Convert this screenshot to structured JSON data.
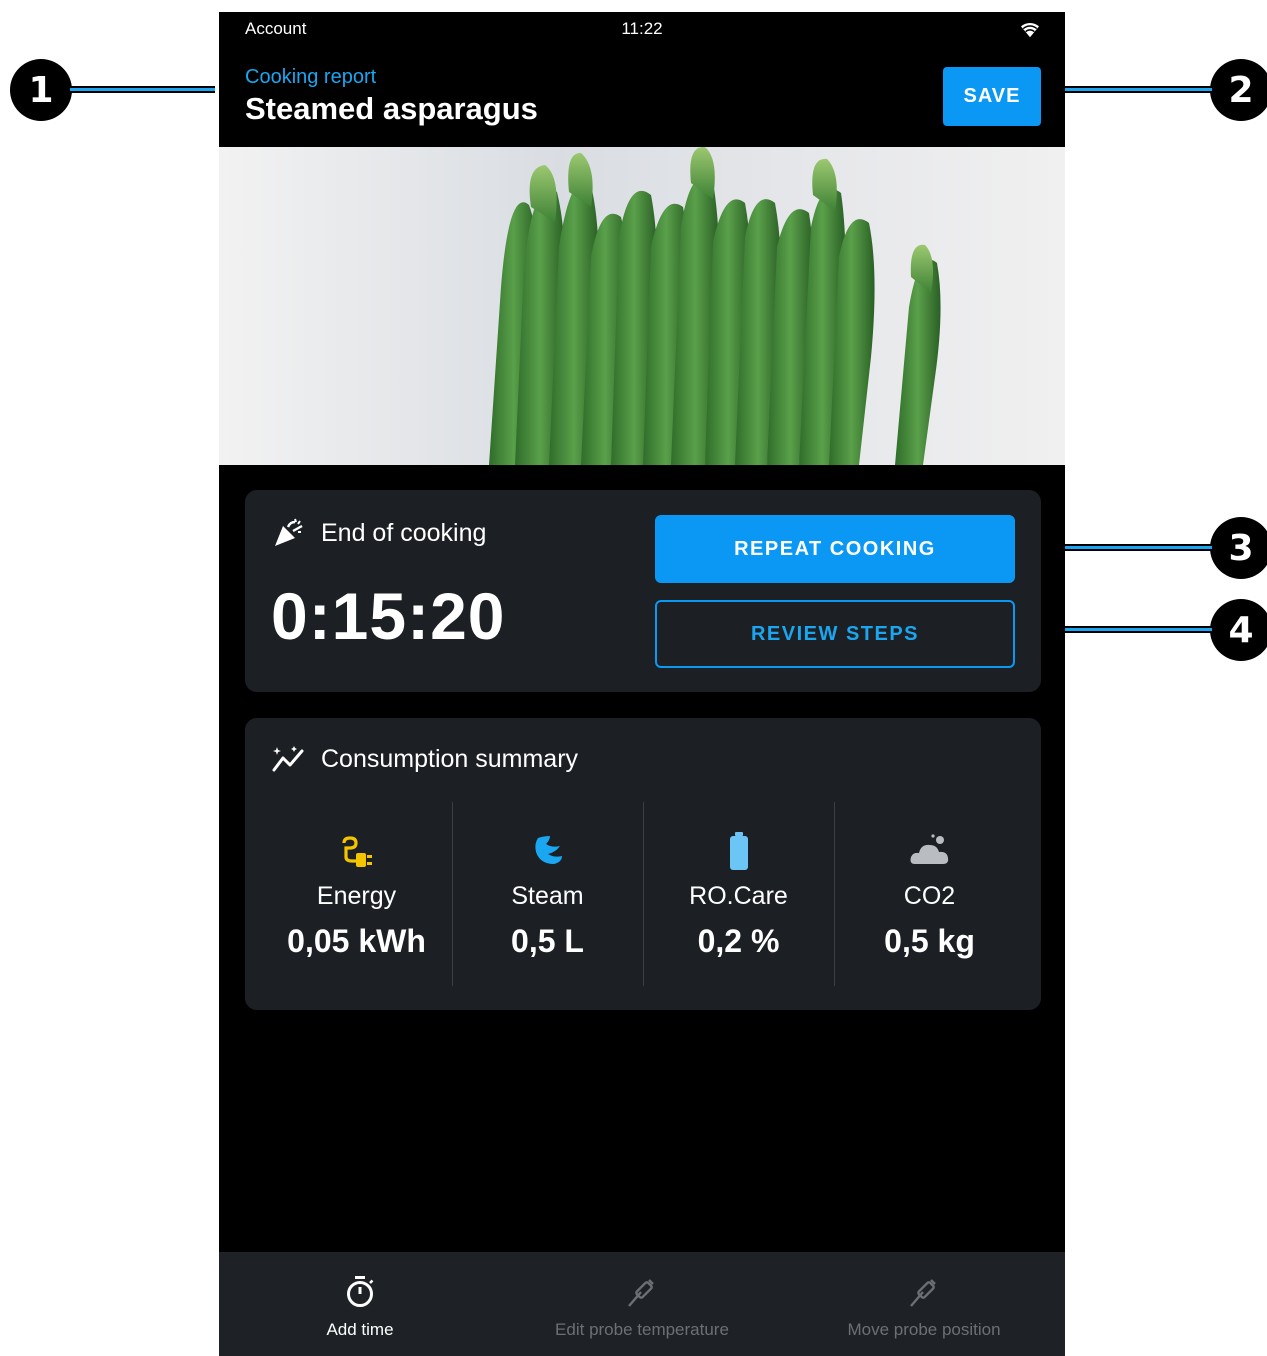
{
  "callouts": [
    "1",
    "2",
    "3",
    "4"
  ],
  "status_bar": {
    "left": "Account",
    "time": "11:22",
    "wifi_icon": "wifi-icon"
  },
  "header": {
    "subtitle": "Cooking report",
    "title": "Steamed asparagus",
    "save_label": "SAVE"
  },
  "hero": {
    "icon": "asparagus-photo"
  },
  "end_card": {
    "icon": "party-popper-icon",
    "title": "End of cooking",
    "time": "0:15:20",
    "repeat_label": "REPEAT COOKING",
    "review_label": "REVIEW STEPS"
  },
  "summary_card": {
    "icon": "sparkle-chart-icon",
    "title": "Consumption summary",
    "metrics": [
      {
        "label": "Energy",
        "value": "0,05 kWh",
        "icon": "energy-plug-icon",
        "color": "#f5c400"
      },
      {
        "label": "Steam",
        "value": "0,5 L",
        "icon": "steam-icon",
        "color": "#1aa6f0"
      },
      {
        "label": "RO.Care",
        "value": "0,2 %",
        "icon": "battery-icon",
        "color": "#6cc6f5"
      },
      {
        "label": "CO2",
        "value": "0,5 kg",
        "icon": "cloud-icon",
        "color": "#b9bcc0"
      }
    ]
  },
  "bottom_bar": {
    "tabs": [
      {
        "label": "Add time",
        "icon": "stopwatch-icon",
        "state": "active"
      },
      {
        "label": "Edit probe temperature",
        "icon": "probe-icon",
        "state": "disabled"
      },
      {
        "label": "Move probe position",
        "icon": "probe-icon",
        "state": "disabled"
      }
    ]
  },
  "colors": {
    "accent": "#0b98f4",
    "card": "#1c2024",
    "background": "#000000"
  }
}
